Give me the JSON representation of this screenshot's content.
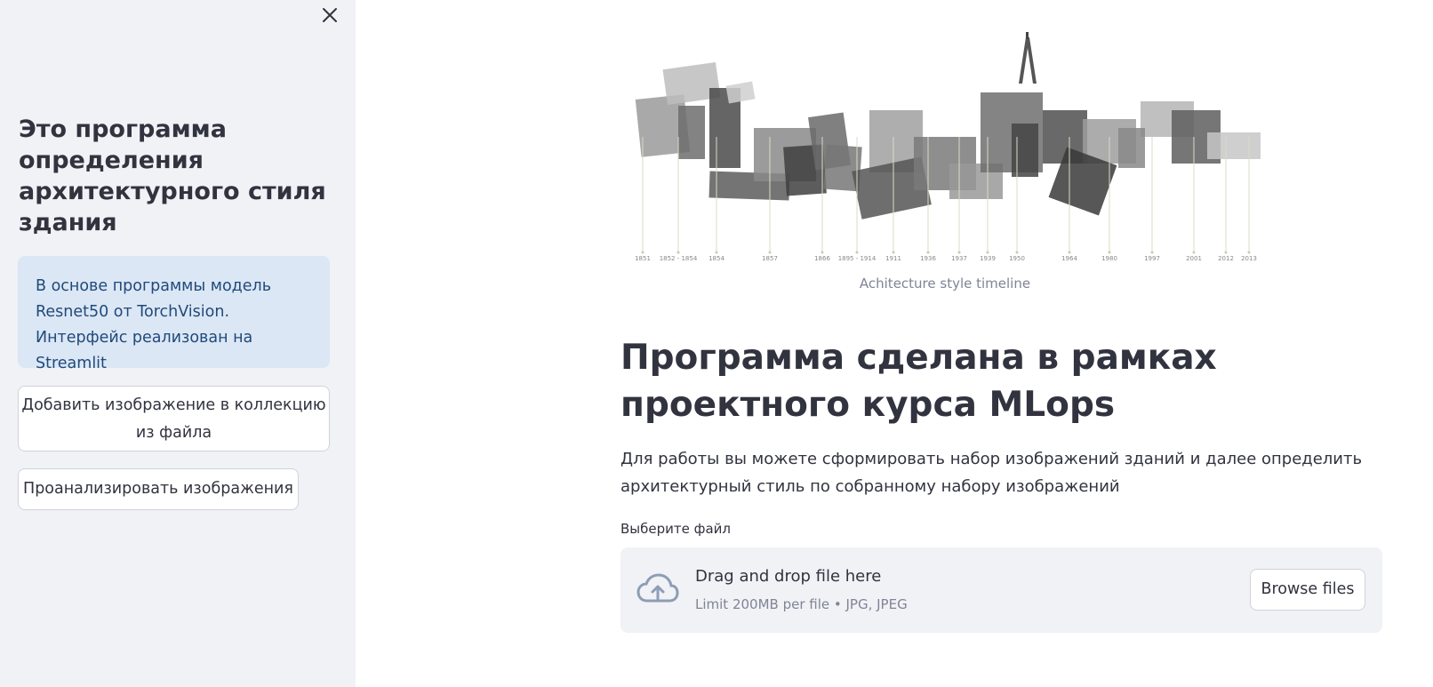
{
  "sidebar": {
    "title": "Это программа определения архитектурного стиля здания",
    "info": "В основе программы модель Resnet50 от TorchVision. Интерфейс реализован на Streamlit",
    "buttons": {
      "add_image": "Добавить изображение в коллекцию из файла",
      "analyze": "Проанализировать изображения"
    }
  },
  "main": {
    "image_caption": "Achitecture style timeline",
    "timeline_years": [
      "1851",
      "1852 - 1854",
      "1854",
      "1857",
      "1866",
      "1895 - 1914",
      "1911",
      "1936",
      "1937",
      "1939",
      "1950",
      "1964",
      "1980",
      "1997",
      "2001",
      "2012",
      "2013"
    ],
    "title": "Программа сделана в рамках проектного курса MLops",
    "description": "Для работы вы можете сформировать набор изображений зданий и далее определить архитектурный стиль по собранному набору изображений",
    "uploader": {
      "label": "Выберите файл",
      "drag_text": "Drag and drop file here",
      "limit_text": "Limit 200MB per file • JPG, JPEG",
      "browse_label": "Browse files"
    }
  },
  "colors": {
    "sidebar_bg": "#f0f2f6",
    "info_bg": "#dce7f5",
    "info_text": "#1f4a7a",
    "text": "#31333f",
    "muted": "#808495"
  }
}
